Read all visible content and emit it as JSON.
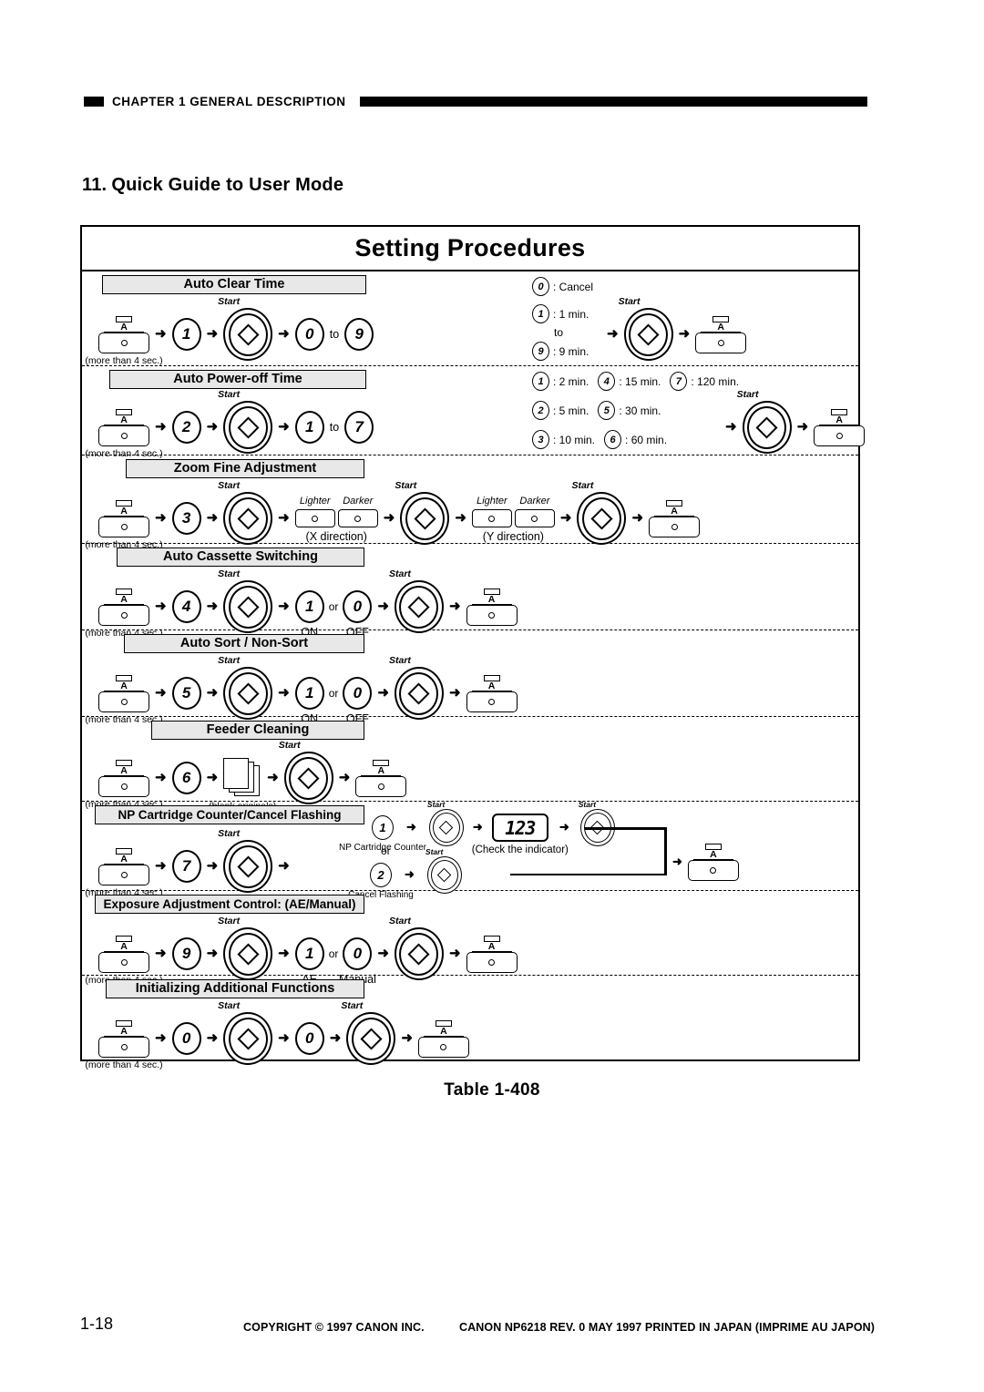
{
  "header": {
    "chapter": "CHAPTER 1  GENERAL DESCRIPTION"
  },
  "section": {
    "number": "11.",
    "title": "Quick Guide to User Mode"
  },
  "figure": {
    "title": "Setting Procedures",
    "caption": "Table 1-408",
    "hold_note": "(more than 4 sec.)",
    "arrow_glyph": "➜",
    "to_label": "to",
    "or_label": "or",
    "start_label": "Start",
    "af_key_letter": "A",
    "procedures": [
      {
        "name": "Auto Clear Time",
        "mode_digit": "1",
        "range_from": "0",
        "range_to": "9",
        "options": [
          {
            "digit": "0",
            "text": ": Cancel"
          },
          {
            "digit": "1",
            "text": ": 1 min."
          },
          {
            "digit": "9",
            "text": ": 9 min."
          }
        ],
        "options_mid": "to"
      },
      {
        "name": "Auto Power-off Time",
        "mode_digit": "2",
        "range_from": "1",
        "range_to": "7",
        "options_grid": [
          [
            {
              "digit": "1",
              "text": ": 2 min."
            },
            {
              "digit": "4",
              "text": ": 15 min."
            },
            {
              "digit": "7",
              "text": ": 120 min."
            }
          ],
          [
            {
              "digit": "2",
              "text": ": 5 min."
            },
            {
              "digit": "5",
              "text": ": 30 min."
            }
          ],
          [
            {
              "digit": "3",
              "text": ": 10 min."
            },
            {
              "digit": "6",
              "text": ": 60 min."
            }
          ]
        ]
      },
      {
        "name": "Zoom Fine Adjustment",
        "mode_digit": "3",
        "lighter_label": "Lighter",
        "darker_label": "Darker",
        "x_direction": "(X direction)",
        "y_direction": "(Y direction)"
      },
      {
        "name": "Auto Cassette Switching",
        "mode_digit": "4",
        "on_digit": "1",
        "off_digit": "0",
        "on_label": "ON",
        "off_label": "OFF"
      },
      {
        "name": "Auto Sort / Non-Sort",
        "mode_digit": "5",
        "on_digit": "1",
        "off_digit": "0",
        "on_label": "ON",
        "off_label": "OFF"
      },
      {
        "name": "Feeder Cleaning",
        "mode_digit": "6",
        "originals_note": "(blank originals)"
      },
      {
        "name": "NP Cartridge Counter/Cancel Flashing",
        "mode_digit": "7",
        "branch_a_digit": "1",
        "branch_a_label": "NP Cartridge Counter",
        "branch_b_digit": "2",
        "branch_b_label": "Cancel Flashing",
        "or_label": "or",
        "indicator_value": "123",
        "indicator_note": "(Check the indicator)"
      },
      {
        "name": "Exposure Adjustment Control: (AE/Manual)",
        "mode_digit": "9",
        "ae_digit": "1",
        "manual_digit": "0",
        "ae_label": "AE",
        "manual_label": "Manual"
      },
      {
        "name": "Initializing Additional Functions",
        "mode_digit": "0",
        "second_digit": "0"
      }
    ]
  },
  "footer": {
    "folio": "1-18",
    "copyright": "COPYRIGHT © 1997 CANON INC.",
    "printline": "CANON NP6218 REV. 0 MAY 1997 PRINTED IN JAPAN (IMPRIME AU JAPON)"
  }
}
